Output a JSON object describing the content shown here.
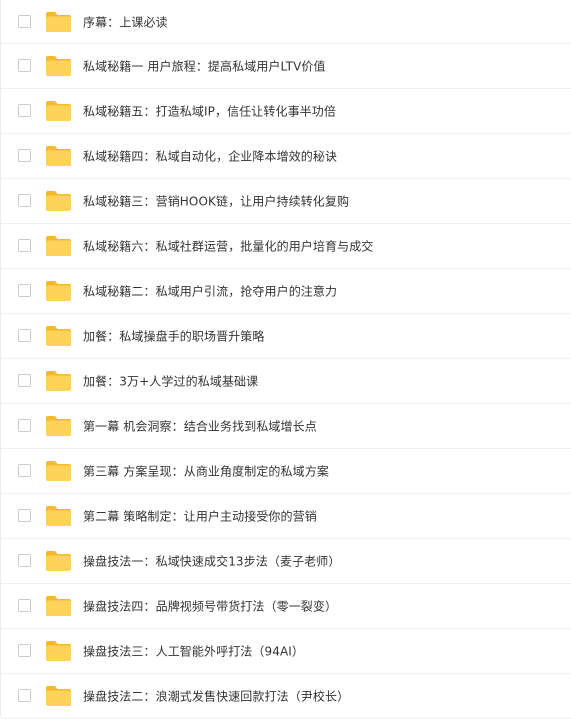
{
  "colors": {
    "folder_front": "#FFD25A",
    "folder_back": "#F5B82E",
    "text": "#333333",
    "divider": "#EEF0F3"
  },
  "files": [
    {
      "name": "序幕：上课必读",
      "icon": "folder-icon"
    },
    {
      "name": "私域秘籍一 用户旅程：提高私域用户LTV价值",
      "icon": "folder-icon"
    },
    {
      "name": "私域秘籍五：打造私域IP，信任让转化事半功倍",
      "icon": "folder-icon"
    },
    {
      "name": "私域秘籍四：私域自动化，企业降本增效的秘诀",
      "icon": "folder-icon"
    },
    {
      "name": "私域秘籍三：营销HOOK链，让用户持续转化复购",
      "icon": "folder-icon"
    },
    {
      "name": "私域秘籍六：私域社群运营，批量化的用户培育与成交",
      "icon": "folder-icon"
    },
    {
      "name": "私域秘籍二：私域用户引流，抢夺用户的注意力",
      "icon": "folder-icon"
    },
    {
      "name": "加餐：私域操盘手的职场晋升策略",
      "icon": "folder-icon"
    },
    {
      "name": "加餐：3万+人学过的私域基础课",
      "icon": "folder-icon"
    },
    {
      "name": "第一幕 机会洞察：结合业务找到私域增长点",
      "icon": "folder-icon"
    },
    {
      "name": "第三幕 方案呈现：从商业角度制定的私域方案",
      "icon": "folder-icon"
    },
    {
      "name": "第二幕 策略制定：让用户主动接受你的营销",
      "icon": "folder-icon"
    },
    {
      "name": "操盘技法一：私域快速成交13步法（麦子老师）",
      "icon": "folder-icon"
    },
    {
      "name": "操盘技法四：品牌视频号带货打法（零一裂变）",
      "icon": "folder-icon"
    },
    {
      "name": "操盘技法三：人工智能外呼打法（94AI）",
      "icon": "folder-icon"
    },
    {
      "name": "操盘技法二：浪潮式发售快速回款打法（尹校长）",
      "icon": "folder-icon"
    }
  ]
}
